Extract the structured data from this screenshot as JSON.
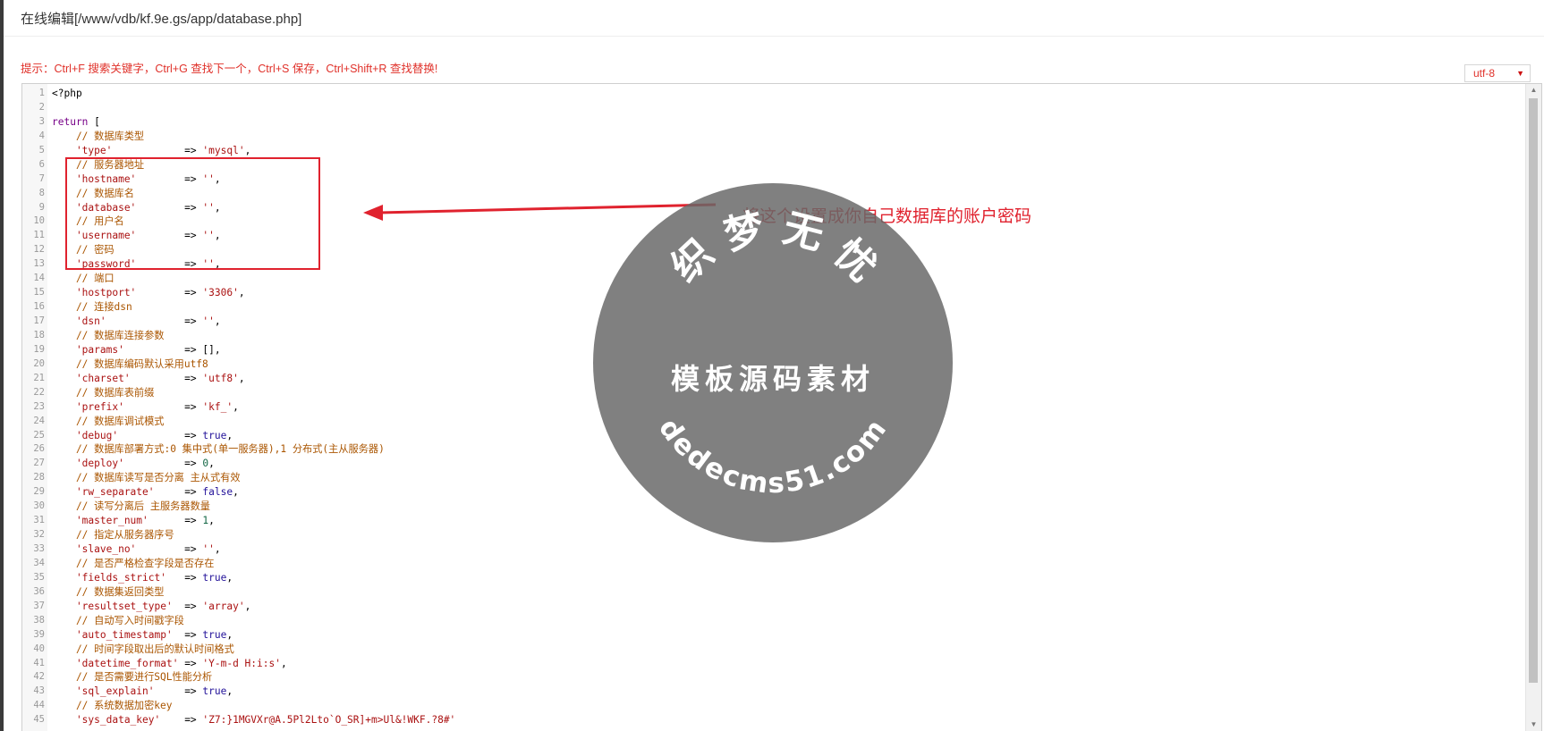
{
  "window": {
    "title": "在线编辑[/www/vdb/kf.9e.gs/app/database.php]"
  },
  "hint": "提示：Ctrl+F 搜索关键字，Ctrl+G 查找下一个，Ctrl+S 保存，Ctrl+Shift+R 查找替换!",
  "encoding": {
    "selected": "utf-8"
  },
  "editor": {
    "language": "php",
    "lines": [
      [
        {
          "t": "plain",
          "v": "<?php"
        }
      ],
      [],
      [
        {
          "t": "kw",
          "v": "return"
        },
        {
          "t": "plain",
          "v": " ["
        }
      ],
      [
        {
          "t": "cmt",
          "v": "    // 数据库类型"
        }
      ],
      [
        {
          "t": "str",
          "v": "    'type'"
        },
        {
          "t": "plain",
          "v": "            => "
        },
        {
          "t": "str",
          "v": "'mysql'"
        },
        {
          "t": "plain",
          "v": ","
        }
      ],
      [
        {
          "t": "cmt",
          "v": "    // 服务器地址"
        }
      ],
      [
        {
          "t": "str",
          "v": "    'hostname'"
        },
        {
          "t": "plain",
          "v": "        => "
        },
        {
          "t": "str",
          "v": "''"
        },
        {
          "t": "plain",
          "v": ","
        }
      ],
      [
        {
          "t": "cmt",
          "v": "    // 数据库名"
        }
      ],
      [
        {
          "t": "str",
          "v": "    'database'"
        },
        {
          "t": "plain",
          "v": "        => "
        },
        {
          "t": "str",
          "v": "''"
        },
        {
          "t": "plain",
          "v": ","
        }
      ],
      [
        {
          "t": "cmt",
          "v": "    // 用户名"
        }
      ],
      [
        {
          "t": "str",
          "v": "    'username'"
        },
        {
          "t": "plain",
          "v": "        => "
        },
        {
          "t": "str",
          "v": "''"
        },
        {
          "t": "plain",
          "v": ","
        }
      ],
      [
        {
          "t": "cmt",
          "v": "    // 密码"
        }
      ],
      [
        {
          "t": "str",
          "v": "    'password'"
        },
        {
          "t": "plain",
          "v": "        => "
        },
        {
          "t": "str",
          "v": "''"
        },
        {
          "t": "plain",
          "v": ","
        }
      ],
      [
        {
          "t": "cmt",
          "v": "    // 端口"
        }
      ],
      [
        {
          "t": "str",
          "v": "    'hostport'"
        },
        {
          "t": "plain",
          "v": "        => "
        },
        {
          "t": "str",
          "v": "'3306'"
        },
        {
          "t": "plain",
          "v": ","
        }
      ],
      [
        {
          "t": "cmt",
          "v": "    // 连接dsn"
        }
      ],
      [
        {
          "t": "str",
          "v": "    'dsn'"
        },
        {
          "t": "plain",
          "v": "             => "
        },
        {
          "t": "str",
          "v": "''"
        },
        {
          "t": "plain",
          "v": ","
        }
      ],
      [
        {
          "t": "cmt",
          "v": "    // 数据库连接参数"
        }
      ],
      [
        {
          "t": "str",
          "v": "    'params'"
        },
        {
          "t": "plain",
          "v": "          => [],"
        }
      ],
      [
        {
          "t": "cmt",
          "v": "    // 数据库编码默认采用utf8"
        }
      ],
      [
        {
          "t": "str",
          "v": "    'charset'"
        },
        {
          "t": "plain",
          "v": "         => "
        },
        {
          "t": "str",
          "v": "'utf8'"
        },
        {
          "t": "plain",
          "v": ","
        }
      ],
      [
        {
          "t": "cmt",
          "v": "    // 数据库表前缀"
        }
      ],
      [
        {
          "t": "str",
          "v": "    'prefix'"
        },
        {
          "t": "plain",
          "v": "          => "
        },
        {
          "t": "str",
          "v": "'kf_'"
        },
        {
          "t": "plain",
          "v": ","
        }
      ],
      [
        {
          "t": "cmt",
          "v": "    // 数据库调试模式"
        }
      ],
      [
        {
          "t": "str",
          "v": "    'debug'"
        },
        {
          "t": "plain",
          "v": "           => "
        },
        {
          "t": "atom",
          "v": "true"
        },
        {
          "t": "plain",
          "v": ","
        }
      ],
      [
        {
          "t": "cmt",
          "v": "    // 数据库部署方式:0 集中式(单一服务器),1 分布式(主从服务器)"
        }
      ],
      [
        {
          "t": "str",
          "v": "    'deploy'"
        },
        {
          "t": "plain",
          "v": "          => "
        },
        {
          "t": "num",
          "v": "0"
        },
        {
          "t": "plain",
          "v": ","
        }
      ],
      [
        {
          "t": "cmt",
          "v": "    // 数据库读写是否分离 主从式有效"
        }
      ],
      [
        {
          "t": "str",
          "v": "    'rw_separate'"
        },
        {
          "t": "plain",
          "v": "     => "
        },
        {
          "t": "atom",
          "v": "false"
        },
        {
          "t": "plain",
          "v": ","
        }
      ],
      [
        {
          "t": "cmt",
          "v": "    // 读写分离后 主服务器数量"
        }
      ],
      [
        {
          "t": "str",
          "v": "    'master_num'"
        },
        {
          "t": "plain",
          "v": "      => "
        },
        {
          "t": "num",
          "v": "1"
        },
        {
          "t": "plain",
          "v": ","
        }
      ],
      [
        {
          "t": "cmt",
          "v": "    // 指定从服务器序号"
        }
      ],
      [
        {
          "t": "str",
          "v": "    'slave_no'"
        },
        {
          "t": "plain",
          "v": "        => "
        },
        {
          "t": "str",
          "v": "''"
        },
        {
          "t": "plain",
          "v": ","
        }
      ],
      [
        {
          "t": "cmt",
          "v": "    // 是否严格检查字段是否存在"
        }
      ],
      [
        {
          "t": "str",
          "v": "    'fields_strict'"
        },
        {
          "t": "plain",
          "v": "   => "
        },
        {
          "t": "atom",
          "v": "true"
        },
        {
          "t": "plain",
          "v": ","
        }
      ],
      [
        {
          "t": "cmt",
          "v": "    // 数据集返回类型"
        }
      ],
      [
        {
          "t": "str",
          "v": "    'resultset_type'"
        },
        {
          "t": "plain",
          "v": "  => "
        },
        {
          "t": "str",
          "v": "'array'"
        },
        {
          "t": "plain",
          "v": ","
        }
      ],
      [
        {
          "t": "cmt",
          "v": "    // 自动写入时间戳字段"
        }
      ],
      [
        {
          "t": "str",
          "v": "    'auto_timestamp'"
        },
        {
          "t": "plain",
          "v": "  => "
        },
        {
          "t": "atom",
          "v": "true"
        },
        {
          "t": "plain",
          "v": ","
        }
      ],
      [
        {
          "t": "cmt",
          "v": "    // 时间字段取出后的默认时间格式"
        }
      ],
      [
        {
          "t": "str",
          "v": "    'datetime_format'"
        },
        {
          "t": "plain",
          "v": " => "
        },
        {
          "t": "str",
          "v": "'Y-m-d H:i:s'"
        },
        {
          "t": "plain",
          "v": ","
        }
      ],
      [
        {
          "t": "cmt",
          "v": "    // 是否需要进行SQL性能分析"
        }
      ],
      [
        {
          "t": "str",
          "v": "    'sql_explain'"
        },
        {
          "t": "plain",
          "v": "     => "
        },
        {
          "t": "atom",
          "v": "true"
        },
        {
          "t": "plain",
          "v": ","
        }
      ],
      [
        {
          "t": "cmt",
          "v": "    // 系统数据加密key"
        }
      ],
      [
        {
          "t": "str",
          "v": "    'sys_data_key'"
        },
        {
          "t": "plain",
          "v": "    => "
        },
        {
          "t": "str",
          "v": "'Z7:}1MGVXr@A.5Pl2Lto`O_SR]+m>Ul&!WKF.?8#'"
        }
      ]
    ]
  },
  "annotation": {
    "text": "将这个设置成你自己数据库的账户密码",
    "color": "#e0222e"
  },
  "watermark": {
    "top_text": "织 梦 无 忧",
    "middle_text": "模板源码素材",
    "bottom_text": "dedecms51.com"
  },
  "colors": {
    "hint": "#e0312a",
    "comment": "#aa5500",
    "string": "#aa1111",
    "keyword": "#770088",
    "atom": "#221199",
    "number": "#116644"
  }
}
